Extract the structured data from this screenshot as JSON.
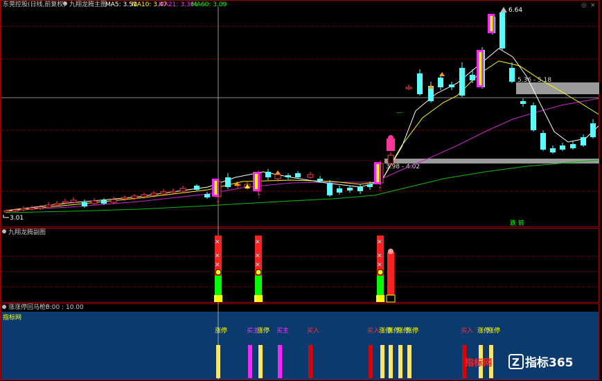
{
  "main_panel": {
    "title": "东莞控股(日线,前复权)",
    "indicator_name": "九翔龙腾主图",
    "ma5": "MA5: 3.51",
    "ma10": "MA10: 3.47",
    "ma21": "MA21: 3.36",
    "ma60": "MA60: 3.09",
    "high_label": "6.64",
    "low_label": "3.01",
    "zone_label_upper": "5.36 - 5.18",
    "zone_label_lower": "3.98 - 4.02",
    "signal_text": "跌 转"
  },
  "mid_panel": {
    "title": "九翔龙腾副图"
  },
  "low_panel": {
    "title": "涨涨停回马枪F",
    "time_range": "0:00 : 10.00",
    "corner_label": "指标网",
    "signals": [
      {
        "text": "涨停",
        "color": "#ffff00"
      },
      {
        "text": "买主",
        "color": "#ff33ff"
      },
      {
        "text": "涨停",
        "color": "#ffff00"
      },
      {
        "text": "买主",
        "color": "#ff33ff"
      },
      {
        "text": "买入",
        "color": "#ff3333"
      },
      {
        "text": "买入",
        "color": "#ff3333"
      },
      {
        "text": "涨停",
        "color": "#ffff00"
      },
      {
        "text": "涨停",
        "color": "#ffff00"
      },
      {
        "text": "涨停",
        "color": "#ffff00"
      },
      {
        "text": "涨停",
        "color": "#ffff00"
      },
      {
        "text": "买入",
        "color": "#ff3333"
      },
      {
        "text": "涨停",
        "color": "#ffff00"
      },
      {
        "text": "涨停",
        "color": "#ffff00"
      }
    ],
    "red_watermark": "指标网"
  },
  "watermark": {
    "text": "指标365"
  },
  "colors": {
    "up": "#ff4040",
    "down": "#54ffff",
    "ma5": "#ffffff",
    "ma10": "#ffff00",
    "ma21": "#ff33ff",
    "ma60": "#00ff00",
    "panel_border": "#a00000",
    "low_bg": "#0b3a6e"
  }
}
